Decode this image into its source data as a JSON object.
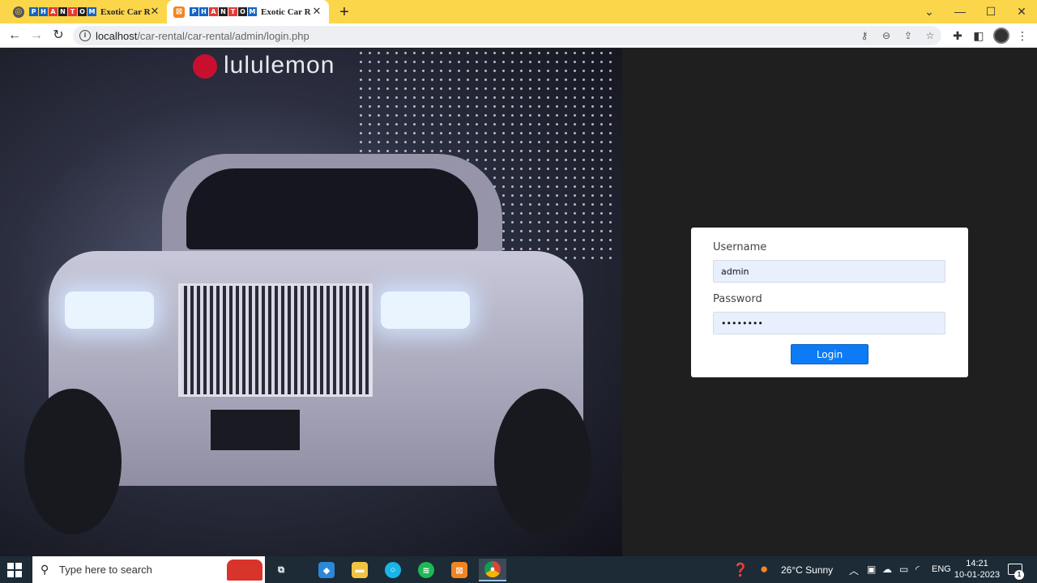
{
  "browser": {
    "tabs": [
      {
        "logo_letters": [
          "P",
          "H",
          "A",
          "N",
          "T",
          "O",
          "M"
        ],
        "title": "Exotic Car Rental",
        "favicon": "globe-icon",
        "active": false
      },
      {
        "logo_letters": [
          "P",
          "H",
          "A",
          "N",
          "T",
          "O",
          "M"
        ],
        "title": "Exotic Car Rental",
        "favicon": "xampp-icon",
        "active": true
      }
    ],
    "logo_colors": [
      "#1565c0",
      "#1565c0",
      "#e53935",
      "#212121",
      "#e53935",
      "#212121",
      "#1565c0"
    ],
    "url_host": "localhost",
    "url_path": "/car-rental/car-rental/admin/login.php",
    "accent_color": "#fcd64a"
  },
  "hero": {
    "store_sign": "lululemon"
  },
  "login": {
    "username_label": "Username",
    "username_value": "admin",
    "password_label": "Password",
    "password_value": "••••••••",
    "submit_label": "Login",
    "button_color": "#0d7bf5"
  },
  "taskbar": {
    "search_placeholder": "Type here to search",
    "weather": "26°C  Sunny",
    "language": "ENG",
    "time": "14:21",
    "date": "10-01-2023",
    "notification_count": "1",
    "apps": [
      "task-view-icon",
      "azure-data-studio-icon",
      "file-explorer-icon",
      "amazon-alexa-icon",
      "spotify-icon",
      "xampp-icon",
      "chrome-icon"
    ]
  }
}
